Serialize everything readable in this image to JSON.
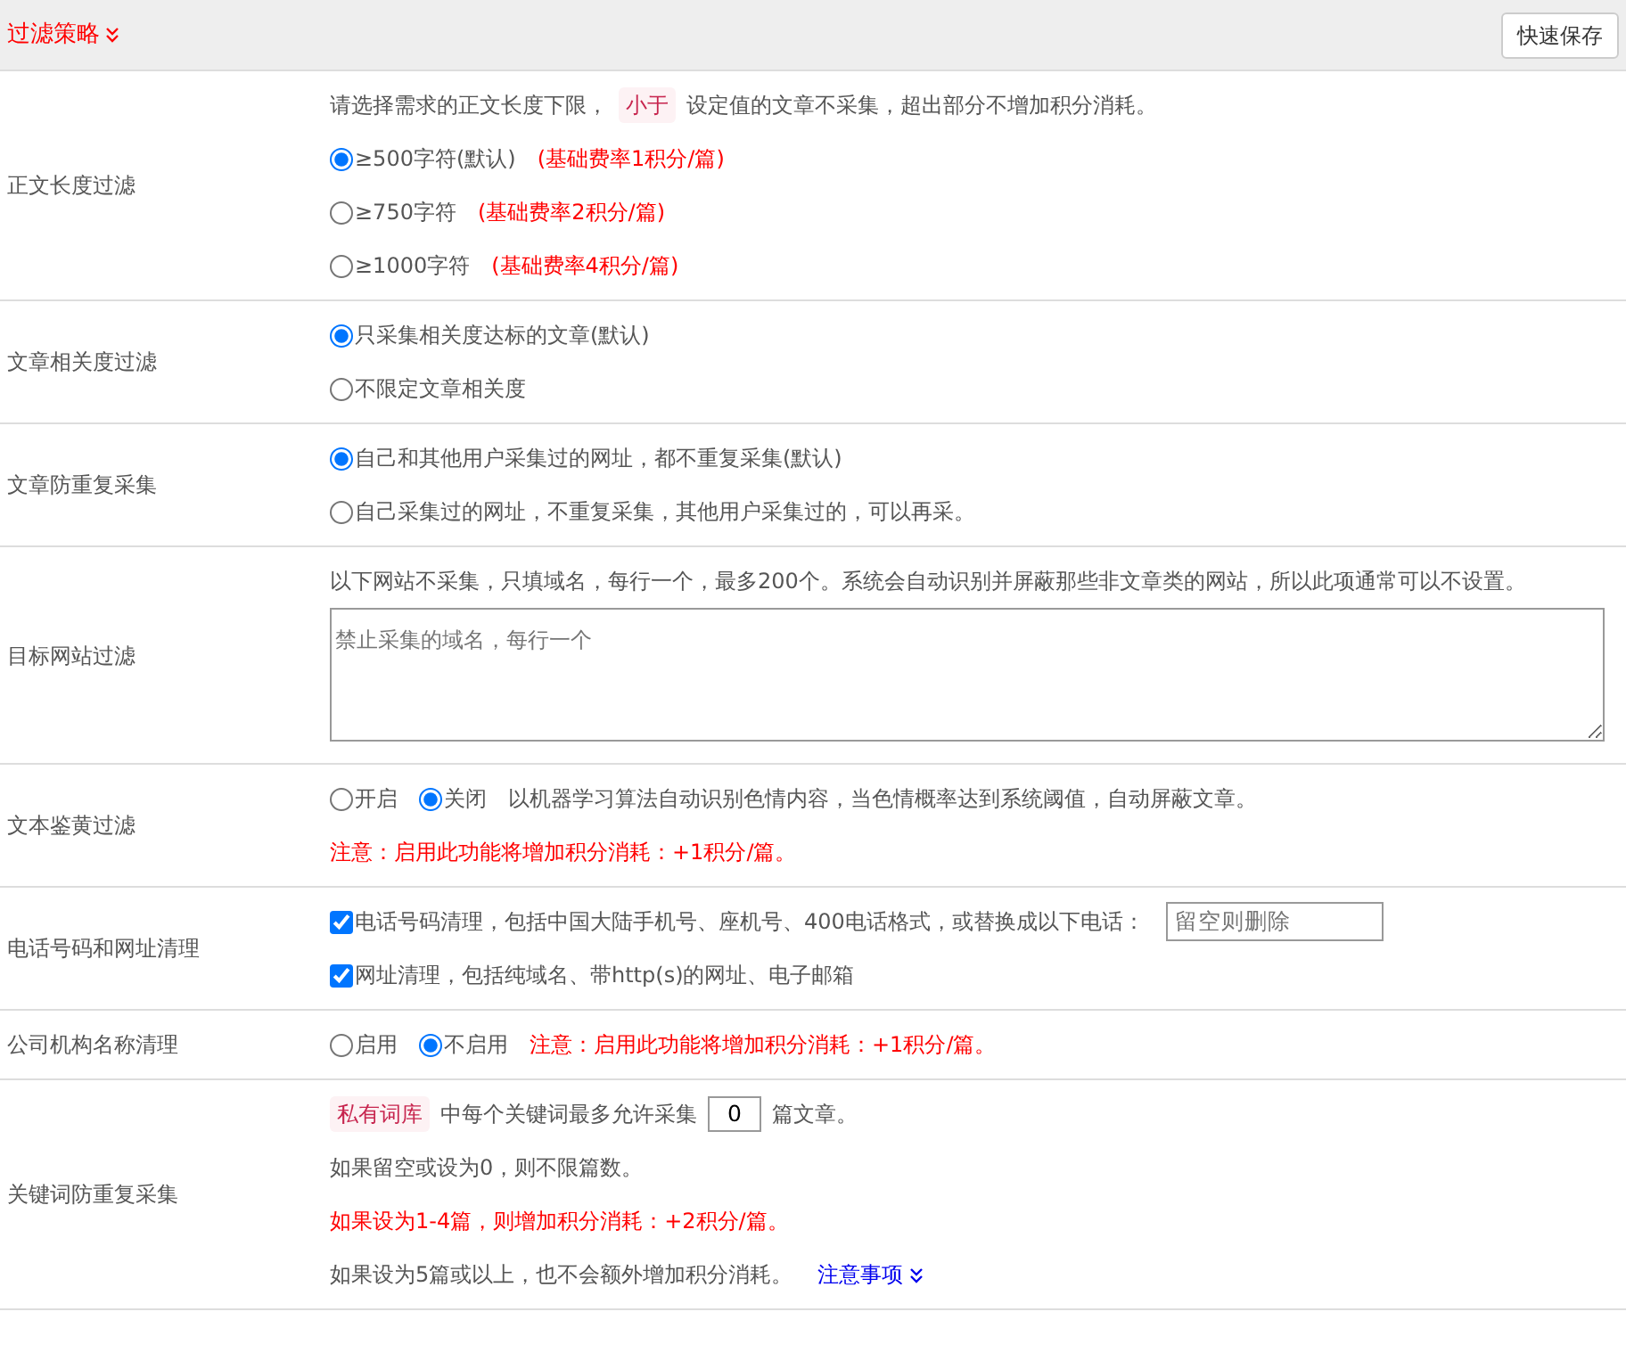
{
  "header": {
    "title": "过滤策略",
    "save_button": "快速保存"
  },
  "rows": [
    {
      "label": "正文长度过滤",
      "lines": [
        [
          {
            "kind": "text",
            "text": "请选择需求的正文长度下限，"
          },
          {
            "kind": "tag",
            "text": "小于"
          },
          {
            "kind": "text",
            "text": "设定值的文章不采集，超出部分不增加积分消耗。"
          }
        ],
        [
          {
            "kind": "radio",
            "text": "≥500字符(默认)",
            "selected": true
          },
          {
            "kind": "red",
            "text": "(基础费率1积分/篇)"
          }
        ],
        [
          {
            "kind": "radio",
            "text": "≥750字符",
            "selected": false
          },
          {
            "kind": "red",
            "text": "(基础费率2积分/篇)"
          }
        ],
        [
          {
            "kind": "radio",
            "text": "≥1000字符",
            "selected": false
          },
          {
            "kind": "red",
            "text": "(基础费率4积分/篇)"
          }
        ]
      ]
    },
    {
      "label": "文章相关度过滤",
      "lines": [
        [
          {
            "kind": "radio",
            "text": "只采集相关度达标的文章(默认)",
            "selected": true
          }
        ],
        [
          {
            "kind": "radio",
            "text": "不限定文章相关度",
            "selected": false
          }
        ]
      ]
    },
    {
      "label": "文章防重复采集",
      "lines": [
        [
          {
            "kind": "radio",
            "text": "自己和其他用户采集过的网址，都不重复采集(默认)",
            "selected": true
          }
        ],
        [
          {
            "kind": "radio",
            "text": "自己采集过的网址，不重复采集，其他用户采集过的，可以再采。",
            "selected": false
          }
        ]
      ]
    },
    {
      "label": "目标网站过滤",
      "lines": [
        [
          {
            "kind": "text",
            "text": "以下网站不采集，只填域名，每行一个，最多200个。系统会自动识别并屏蔽那些非文章类的网站，所以此项通常可以不设置。"
          }
        ],
        [
          {
            "kind": "textarea",
            "placeholder": "禁止采集的域名，每行一个"
          }
        ]
      ]
    },
    {
      "label": "文本鉴黄过滤",
      "lines": [
        [
          {
            "kind": "radio",
            "text": "开启",
            "selected": false
          },
          {
            "kind": "radio",
            "text": "关闭",
            "selected": true
          },
          {
            "kind": "text",
            "text": "以机器学习算法自动识别色情内容，当色情概率达到系统阈值，自动屏蔽文章。"
          }
        ],
        [
          {
            "kind": "red",
            "text": "注意：启用此功能将增加积分消耗：+1积分/篇。"
          }
        ]
      ]
    },
    {
      "label": "电话号码和网址清理",
      "lines": [
        [
          {
            "kind": "checkbox",
            "text": "电话号码清理，包括中国大陆手机号、座机号、400电话格式，或替换成以下电话：",
            "checked": true
          },
          {
            "kind": "input",
            "placeholder": "留空则删除"
          }
        ],
        [
          {
            "kind": "checkbox",
            "text": "网址清理，包括纯域名、带http(s)的网址、电子邮箱",
            "checked": true
          }
        ]
      ]
    },
    {
      "label": "公司机构名称清理",
      "lines": [
        [
          {
            "kind": "radio",
            "text": "启用",
            "selected": false
          },
          {
            "kind": "radio",
            "text": "不启用",
            "selected": true
          },
          {
            "kind": "red",
            "text": "注意：启用此功能将增加积分消耗：+1积分/篇。"
          }
        ]
      ]
    },
    {
      "label": "关键词防重复采集",
      "lines": [
        [
          {
            "kind": "tag",
            "text": "私有词库"
          },
          {
            "kind": "text",
            "text": "中每个关键词最多允许采集"
          },
          {
            "kind": "number",
            "value": "0"
          },
          {
            "kind": "text",
            "text": "篇文章。"
          }
        ],
        [
          {
            "kind": "text",
            "text": "如果留空或设为0，则不限篇数。"
          }
        ],
        [
          {
            "kind": "red",
            "text": "如果设为1-4篇，则增加积分消耗：+2积分/篇。"
          }
        ],
        [
          {
            "kind": "text",
            "text": "如果设为5篇或以上，也不会额外增加积分消耗。"
          },
          {
            "kind": "link",
            "text": "注意事项"
          }
        ]
      ]
    }
  ]
}
